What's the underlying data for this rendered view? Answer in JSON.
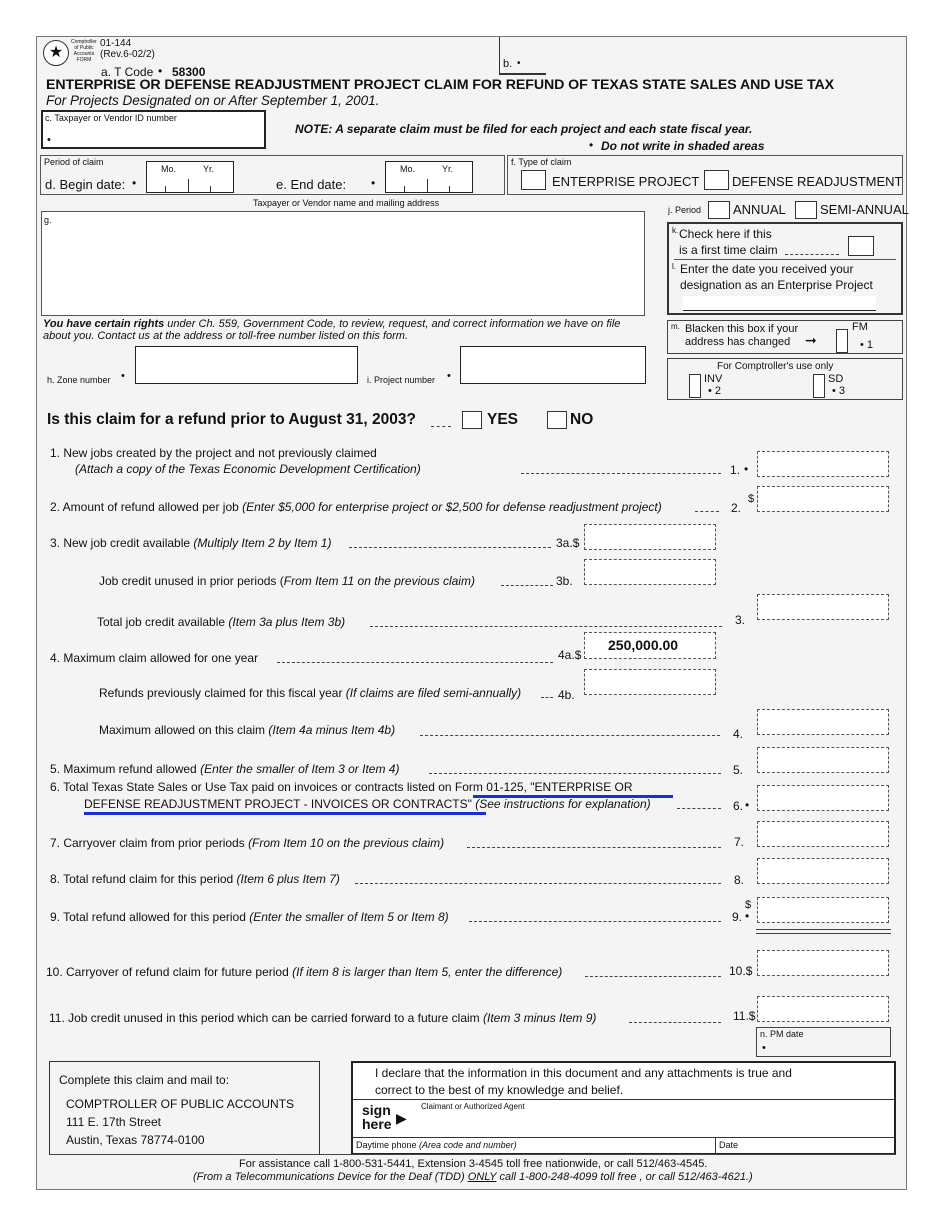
{
  "header": {
    "agency_logo_text": [
      "Comptroller",
      "of Public",
      "Accounts",
      "FORM"
    ],
    "form_number": "01-144",
    "revision": "(Rev.6-02/2)",
    "tcode_label": "a. T Code",
    "tcode_value": "58300",
    "field_b_label": "b.",
    "title": "ENTERPRISE OR DEFENSE READJUSTMENT PROJECT CLAIM FOR REFUND OF TEXAS STATE SALES AND USE TAX",
    "subtitle": "For Projects Designated on or After September 1, 2001.",
    "taxpayer_id_label": "c. Taxpayer or Vendor ID number",
    "note": "NOTE:  A separate claim must be filed for each project and each state fiscal year.",
    "note2": "Do not write in shaded areas"
  },
  "period": {
    "label": "Period of claim",
    "begin_label": "d. Begin date:",
    "end_label": "e.  End date:",
    "mo": "Mo.",
    "yr": "Yr."
  },
  "claim_type": {
    "label": "f. Type of claim",
    "option1": "ENTERPRISE PROJECT",
    "option2": "DEFENSE READJUSTMENT"
  },
  "address": {
    "caption": "Taxpayer or Vendor name and mailing address",
    "label": "g."
  },
  "period_j": {
    "label": "j. Period",
    "option1": "ANNUAL",
    "option2": "SEMI-ANNUAL"
  },
  "first_claim": {
    "k_marker": "k.",
    "line1": "Check here if this",
    "line2": "is a first time claim",
    "l_marker": "l.",
    "line3": "Enter the date you received your",
    "line4": "designation as an Enterprise Project"
  },
  "address_change": {
    "m_marker": "m.",
    "line1": "Blacken this box if your",
    "line2": "address has changed",
    "fm_label": "FM",
    "fm_code": "1"
  },
  "comptroller_use": {
    "title": "For Comptroller's use only",
    "inv_label": "INV",
    "inv_code": "2",
    "sd_label": "SD",
    "sd_code": "3"
  },
  "rights": {
    "bold": "You have certain rights",
    "text": " under Ch. 559, Government Code, to review, request, and correct information we have on file about you.  Contact us at the address or toll-free number listed on this form."
  },
  "zone_label": "h.  Zone number",
  "project_label": "i.  Project number",
  "refund_question": {
    "text": "Is this claim for a refund prior to August 31, 2003?",
    "yes": "YES",
    "no": "NO"
  },
  "lines": {
    "l1_main": "1.  New jobs created by the project and not previously claimed",
    "l1_sub": "(Attach a copy of the Texas Economic Development Certification)",
    "l1_num": "1.",
    "l2_main": "2.  Amount of refund allowed per job ",
    "l2_sub": "(Enter $5,000 for enterprise project or $2,500 for defense readjustment project)",
    "l2_num": "2.",
    "l3a_main": "3.  New job credit available ",
    "l3a_sub": "(Multiply Item 2 by Item 1)",
    "l3a_num": "3a.",
    "l3b_main": "Job credit unused in prior periods (",
    "l3b_sub": "From Item 11 on the previous claim)",
    "l3b_num": "3b.",
    "l3_main": "Total job credit available  ",
    "l3_sub": "(Item 3a plus Item 3b)",
    "l3_num": "3.",
    "l4a_main": "4.  Maximum claim allowed for one year",
    "l4a_num": "4a.",
    "l4a_value": "250,000.00",
    "l4b_main": "Refunds previously claimed for this fiscal year ",
    "l4b_sub": "(If claims are filed semi-annually)",
    "l4b_num": "4b.",
    "l4_main": "Maximum allowed on this claim ",
    "l4_sub": "(Item 4a minus Item 4b)",
    "l4_num": "4.",
    "l5_main": "5.  Maximum refund allowed ",
    "l5_sub": "(Enter the smaller of Item 3 or Item 4)",
    "l5_num": "5.",
    "l6_main1": "6.  Total Texas State Sales or Use Tax paid on invoices or contracts listed on Form 01-125, \"ENTERPRISE OR",
    "l6_main2": "DEFENSE READJUSTMENT PROJECT - INVOICES OR CONTRACTS\" ",
    "l6_sub": "(See instructions for explanation)",
    "l6_num": "6.",
    "l7_main": "7.  Carryover claim from prior periods ",
    "l7_sub": "(From Item 10 on the previous claim)",
    "l7_num": "7.",
    "l8_main": "8.  Total refund claim for this period ",
    "l8_sub": "(Item 6 plus Item 7)",
    "l8_num": "8.",
    "l9_main": "9.  Total refund allowed for this period ",
    "l9_sub": "(Enter the smaller of Item 5 or Item 8)",
    "l9_num": "9.",
    "l10_main": "10.  Carryover of refund claim for future period ",
    "l10_sub": "(If item 8 is larger than Item 5, enter the difference)",
    "l10_num": "10.",
    "l11_main": "11.  Job credit unused in this period which can be carried forward to a future claim  ",
    "l11_sub": "(Item 3 minus Item 9)",
    "l11_num": "11.",
    "dollar": "$",
    "pm_date": "n. PM date"
  },
  "mail_to": {
    "intro": "Complete this claim and mail to:",
    "org": "COMPTROLLER OF PUBLIC ACCOUNTS",
    "street": "111 E. 17th Street",
    "city": "Austin, Texas   78774-0100"
  },
  "declaration": {
    "text1": "I declare that the information in this document and any attachments is true and",
    "text2": "correct to the best of my knowledge and belief.",
    "sign": "sign",
    "here": "here",
    "claimant": "Claimant or Authorized Agent",
    "phone_label": "Daytime phone ",
    "phone_sub": "(Area code and number)",
    "date_label": "Date"
  },
  "footer": {
    "line1": "For assistance call 1-800-531-5441, Extension 3-4545 toll free nationwide, or call 512/463-4545.",
    "line2a": "(From a Telecommunications Device for the Deaf (TDD) ",
    "line2b": "ONLY",
    "line2c": " call 1-800-248-4099 toll free , or call 512/463-4621.)"
  },
  "bullet": "•"
}
